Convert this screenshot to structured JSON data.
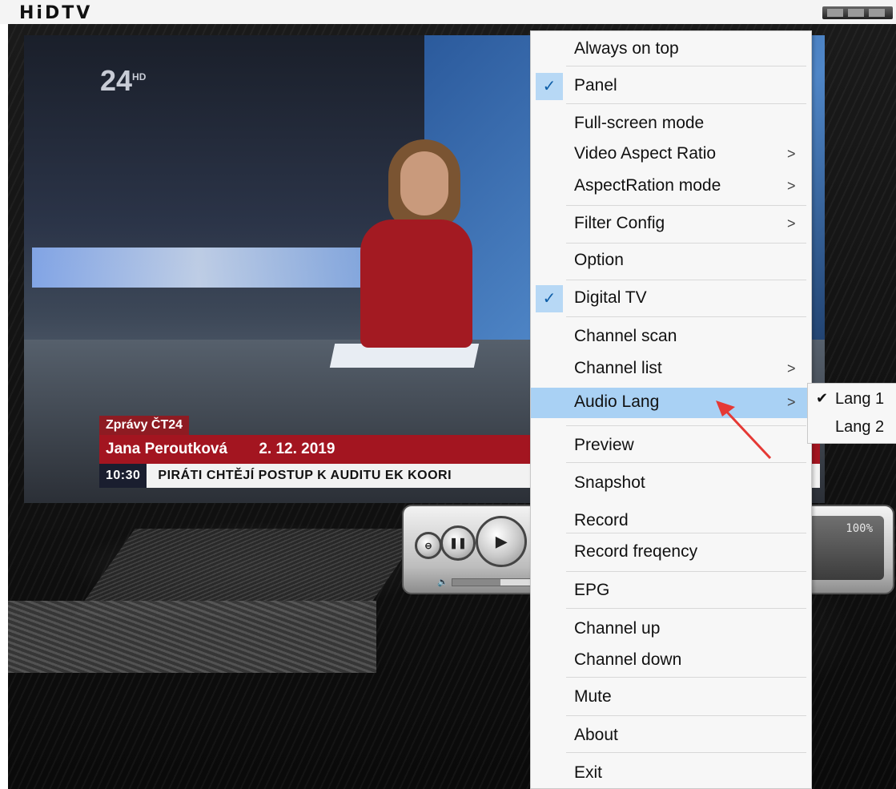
{
  "window": {
    "title": "HiDTV"
  },
  "video": {
    "channel_logo": "24",
    "channel_logo_sup": "HD",
    "show_tag": "Zprávy ČT24",
    "presenter": "Jana Peroutková",
    "date": "2. 12. 2019",
    "ticker_time": "10:30",
    "ticker_text": "PIRÁTI CHTĚJÍ POSTUP K AUDITU EK KOORI"
  },
  "control_panel": {
    "stop_icon": "⊖",
    "pause_icon": "❚❚",
    "play_icon": "▶",
    "volume_icon": "🔈",
    "volume_level": 0.6,
    "zoom_display": "100%"
  },
  "context_menu": {
    "items": [
      {
        "label": "Always on top"
      },
      {
        "label": "Panel",
        "checked": true
      },
      {
        "label": "Full-screen mode"
      },
      {
        "label": "Video Aspect Ratio",
        "submenu": true
      },
      {
        "label": "AspectRation mode",
        "submenu": true
      },
      {
        "label": "Filter Config",
        "submenu": true
      },
      {
        "label": "Option"
      },
      {
        "label": "Digital TV",
        "checked": true
      },
      {
        "label": "Channel scan"
      },
      {
        "label": "Channel list",
        "submenu": true
      },
      {
        "label": "Audio Lang",
        "submenu": true,
        "highlighted": true
      },
      {
        "label": "Preview"
      },
      {
        "label": "Snapshot"
      },
      {
        "label": "Record"
      },
      {
        "label": "Record freqency"
      },
      {
        "label": "EPG"
      },
      {
        "label": "Channel up"
      },
      {
        "label": "Channel down"
      },
      {
        "label": "Mute"
      },
      {
        "label": "About"
      },
      {
        "label": "Exit"
      }
    ],
    "check_glyph": "✓",
    "arrow_glyph": ">"
  },
  "audio_submenu": {
    "items": [
      {
        "label": "Lang 1",
        "checked": true
      },
      {
        "label": "Lang 2"
      }
    ],
    "check_glyph": "✔"
  },
  "colors": {
    "menu_highlight": "#a9d1f4",
    "annotation_arrow": "#e53935"
  }
}
